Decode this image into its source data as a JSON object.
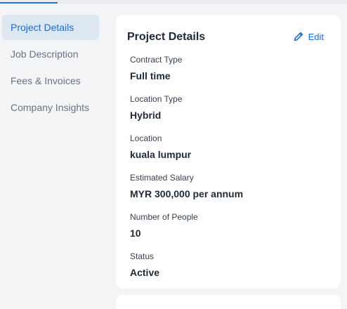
{
  "sidebar": {
    "items": [
      {
        "label": "Project Details",
        "active": true
      },
      {
        "label": "Job Description",
        "active": false
      },
      {
        "label": "Fees & Invoices",
        "active": false
      },
      {
        "label": "Company Insights",
        "active": false
      }
    ]
  },
  "card": {
    "title": "Project Details",
    "edit_label": "Edit",
    "edit_icon": "pencil-icon",
    "fields": [
      {
        "label": "Contract Type",
        "value": "Full time"
      },
      {
        "label": "Location Type",
        "value": "Hybrid"
      },
      {
        "label": "Location",
        "value": "kuala lumpur"
      },
      {
        "label": "Estimated Salary",
        "value": "MYR 300,000 per annum"
      },
      {
        "label": "Number of People",
        "value": "10"
      },
      {
        "label": "Status",
        "value": "Active"
      }
    ]
  },
  "colors": {
    "accent": "#1a6fd1",
    "active_nav_bg": "#dde7f2",
    "page_bg": "#f3f4f6",
    "card_bg": "#ffffff"
  }
}
